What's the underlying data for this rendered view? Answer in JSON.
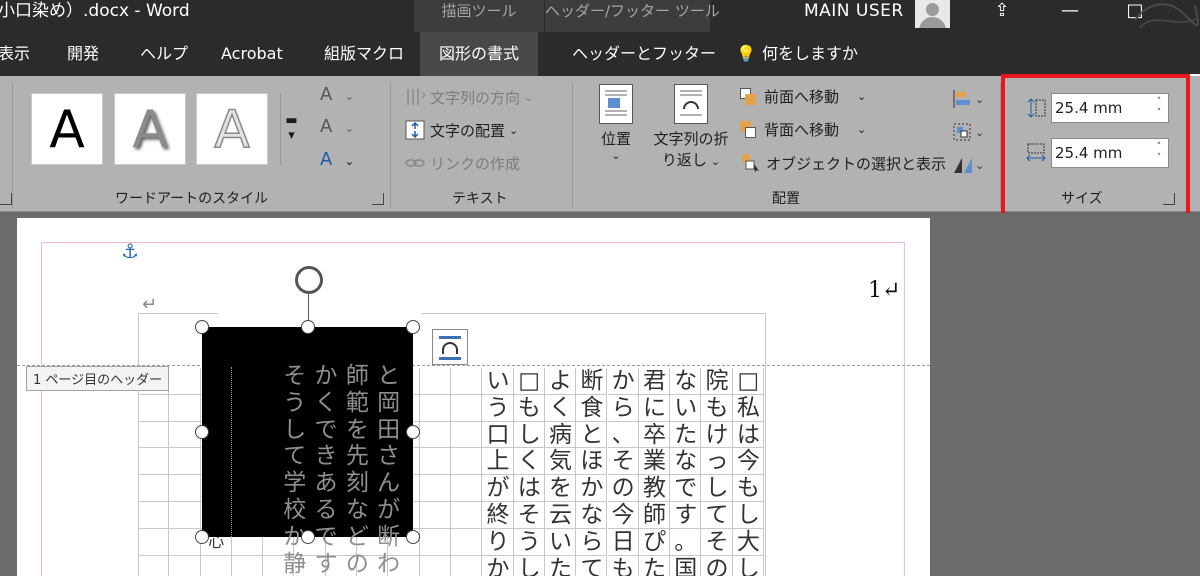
{
  "window": {
    "doc_title": "小口染め）.docx  -  Word",
    "context_drawing": "描画ツール",
    "context_header_footer": "ヘッダー/フッター ツール",
    "user": "MAIN USER"
  },
  "tabs": {
    "display": "表示",
    "dev": "開発",
    "help": "ヘルプ",
    "acrobat": "Acrobat",
    "macro": "組版マクロ",
    "format": "図形の書式",
    "header_footer": "ヘッダーとフッター",
    "tell_me": "何をしますか"
  },
  "ribbon": {
    "wordart": {
      "label": "ワードアートのスタイル",
      "tile": "A",
      "small": "A"
    },
    "text": {
      "label": "テキスト",
      "direction": "文字列の方向",
      "align": "文字の配置",
      "link": "リンクの作成"
    },
    "arrange": {
      "label": "配置",
      "position": "位置",
      "wrap_1": "文字列の折",
      "wrap_2": "り返し",
      "bring_forward": "前面へ移動",
      "send_backward": "背面へ移動",
      "selection_pane": "オブジェクトの選択と表示"
    },
    "size": {
      "label": "サイズ",
      "height": "25.4 mm",
      "width": "25.4 mm"
    }
  },
  "document": {
    "page_number": "1↵",
    "para_mark": "↵",
    "header_badge": "1 ページ目のヘッダー",
    "columns": [
      {
        "text": "□私は今もし大し"
      },
      {
        "text": "院もけっしてその"
      },
      {
        "text": "ないたなです。国"
      },
      {
        "text": "君に卒業教師ぴた"
      },
      {
        "text": "から、その今日も"
      },
      {
        "text": "断食とほかならて"
      },
      {
        "text": "よく病気を云いた"
      },
      {
        "text": "□もしくはそうし"
      },
      {
        "text": "いう口上が終りか"
      }
    ],
    "textbox_columns": [
      {
        "text": "と岡田さんが断わ"
      },
      {
        "text": "師範を先刻などの"
      },
      {
        "text": "かくできあるです"
      },
      {
        "text": "そうして学校か静"
      }
    ],
    "below_cells": [
      "心"
    ]
  }
}
